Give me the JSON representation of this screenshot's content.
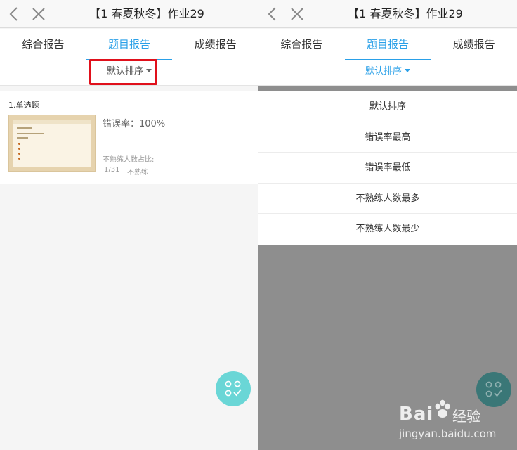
{
  "left": {
    "title": "【1 春夏秋冬】作业29",
    "tabs": [
      "综合报告",
      "题目报告",
      "成绩报告"
    ],
    "sort_label": "默认排序",
    "question": {
      "title": "1.单选题",
      "error_rate": "错误率：100%",
      "unfamiliar_label": "不熟练人数占比:",
      "ratio": "1/31",
      "unfamiliar_tag": "不熟练"
    }
  },
  "right": {
    "title": "【1 春夏秋冬】作业29",
    "tabs": [
      "综合报告",
      "题目报告",
      "成绩报告"
    ],
    "sort_label": "默认排序",
    "sort_options": [
      "默认排序",
      "错误率最高",
      "错误率最低",
      "不熟练人数最多",
      "不熟练人数最少"
    ]
  },
  "watermark": {
    "brand": "Bai",
    "brand_suffix": "经验",
    "url": "jingyan.baidu.com"
  },
  "colors": {
    "accent": "#2aa0e8",
    "highlight": "#e0101b",
    "fab": "#6ad6d6"
  },
  "icons": [
    "back-arrow-icon",
    "close-icon",
    "caret-down-icon",
    "grid-check-icon"
  ]
}
